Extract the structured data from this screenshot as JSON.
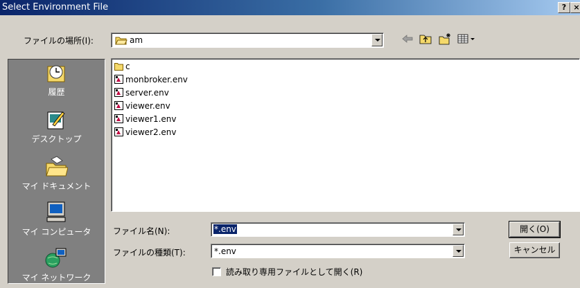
{
  "window": {
    "title": "Select Environment File",
    "help_label": "?",
    "close_label": "×"
  },
  "lookin": {
    "label": "ファイルの場所(I):",
    "value": "am"
  },
  "toolbar": [
    "back-arrow-icon",
    "up-folder-icon",
    "new-folder-icon",
    "view-menu-icon"
  ],
  "places": [
    {
      "label": "履歴",
      "icon": "history-icon"
    },
    {
      "label": "デスクトップ",
      "icon": "desktop-icon"
    },
    {
      "label": "マイ ドキュメント",
      "icon": "my-documents-icon"
    },
    {
      "label": "マイ コンピュータ",
      "icon": "my-computer-icon"
    },
    {
      "label": "マイ ネットワーク",
      "icon": "my-network-icon"
    }
  ],
  "files": [
    {
      "name": "c",
      "type": "folder"
    },
    {
      "name": "monbroker.env",
      "type": "file"
    },
    {
      "name": "server.env",
      "type": "file"
    },
    {
      "name": "viewer.env",
      "type": "file"
    },
    {
      "name": "viewer1.env",
      "type": "file"
    },
    {
      "name": "viewer2.env",
      "type": "file"
    }
  ],
  "filename": {
    "label": "ファイル名(N):",
    "value": "*.env"
  },
  "filetype": {
    "label": "ファイルの種類(T):",
    "value": "*.env"
  },
  "readonly": {
    "label": "読み取り専用ファイルとして開く(R)",
    "checked": false
  },
  "buttons": {
    "open": "開く(O)",
    "cancel": "キャンセル"
  }
}
